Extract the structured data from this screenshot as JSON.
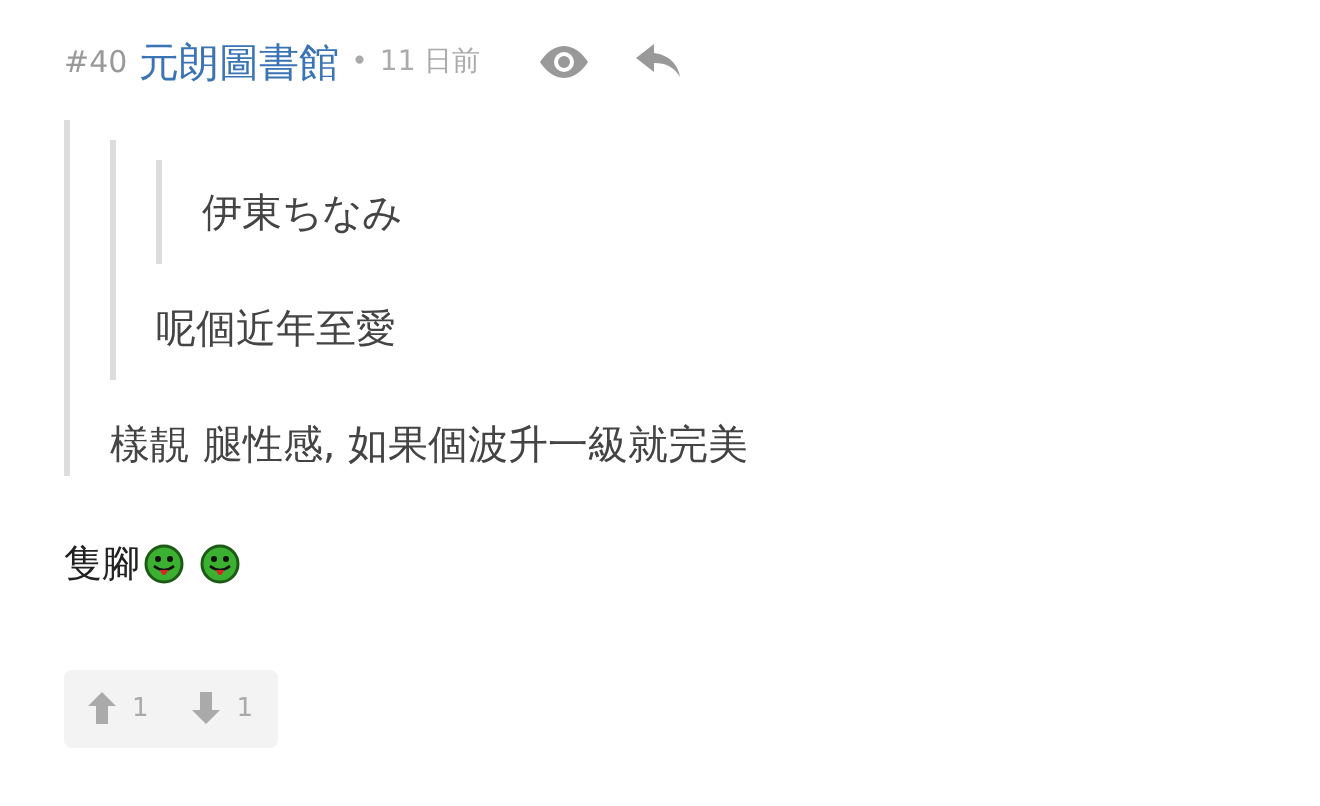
{
  "post": {
    "number": "#40",
    "author": "元朗圖書館",
    "separator": "•",
    "time": "11 日前"
  },
  "quote": {
    "text": "樣靚 腿性感, 如果個波升一級就完美",
    "quote": {
      "text": "呢個近年至愛",
      "quote": {
        "text": "伊東ちなみ"
      }
    }
  },
  "body": {
    "text": "隻腳"
  },
  "votes": {
    "up": "1",
    "down": "1"
  }
}
